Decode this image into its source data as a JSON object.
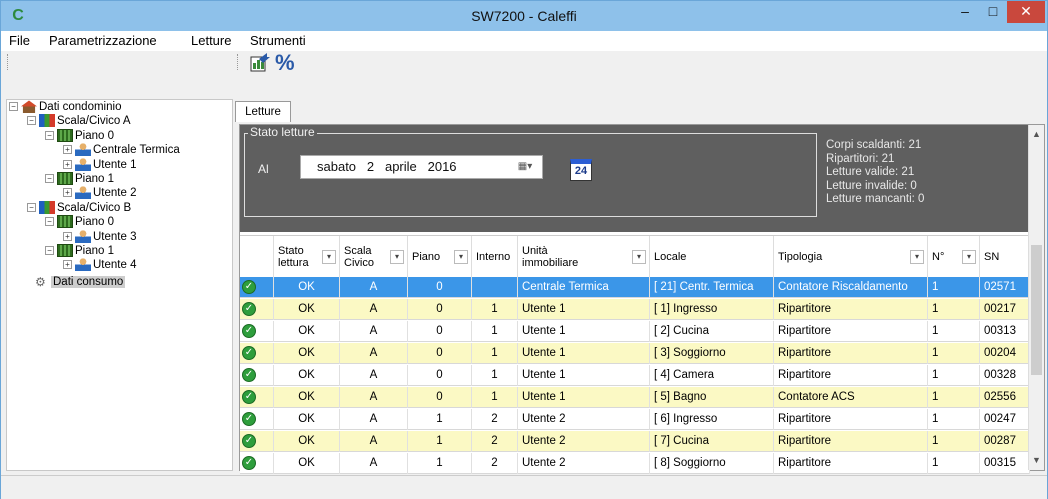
{
  "window": {
    "title": "SW7200 - Caleffi",
    "app_icon": "C",
    "buttons": {
      "minimize": "–",
      "maximize": "□",
      "close": "✕"
    }
  },
  "menu": [
    "File",
    "Parametrizzazione",
    "Letture",
    "Strumenti"
  ],
  "toolbar": {
    "chart_icon": "chart-export-icon",
    "percent": "%"
  },
  "tree": {
    "root": "Dati condominio",
    "scala_a": "Scala/Civico A",
    "piano_a0": "Piano  0",
    "centrale": "Centrale Termica",
    "utente1": "Utente 1",
    "piano_a1": "Piano  1",
    "utente2": "Utente 2",
    "scala_b": "Scala/Civico B",
    "piano_b0": "Piano  0",
    "utente3": "Utente 3",
    "piano_b1": "Piano  1",
    "utente4": "Utente 4",
    "consumo": "Dati consumo"
  },
  "tab": "Letture",
  "stato": {
    "legend": "Stato letture",
    "al": "Al",
    "date_day": "sabato",
    "date_num": "2",
    "date_month": "aprile",
    "date_year": "2016",
    "calendar_num": "24",
    "summary": [
      "Corpi scaldanti: 21",
      "Ripartitori: 21",
      "Letture valide: 21",
      "Letture invalide: 0",
      "Letture mancanti: 0"
    ]
  },
  "columns": {
    "stato": "Stato lettura",
    "scala": "Scala Civico",
    "piano": "Piano",
    "interno": "Interno",
    "unita": "Unità immobiliare",
    "locale": "Locale",
    "tipologia": "Tipologia",
    "numero": "N°",
    "sn": "SN"
  },
  "rows": [
    {
      "stato": "OK",
      "scala": "A",
      "piano": "0",
      "interno": "",
      "unita": "Centrale Termica",
      "locale": "[ 21] Centr. Termica",
      "tipologia": "Contatore Riscaldamento",
      "n": "1",
      "sn": "02571"
    },
    {
      "stato": "OK",
      "scala": "A",
      "piano": "0",
      "interno": "1",
      "unita": "Utente 1",
      "locale": "[  1] Ingresso",
      "tipologia": "Ripartitore",
      "n": "1",
      "sn": "00217"
    },
    {
      "stato": "OK",
      "scala": "A",
      "piano": "0",
      "interno": "1",
      "unita": "Utente 1",
      "locale": "[  2] Cucina",
      "tipologia": "Ripartitore",
      "n": "1",
      "sn": "00313"
    },
    {
      "stato": "OK",
      "scala": "A",
      "piano": "0",
      "interno": "1",
      "unita": "Utente 1",
      "locale": "[  3] Soggiorno",
      "tipologia": "Ripartitore",
      "n": "1",
      "sn": "00204"
    },
    {
      "stato": "OK",
      "scala": "A",
      "piano": "0",
      "interno": "1",
      "unita": "Utente 1",
      "locale": "[  4] Camera",
      "tipologia": "Ripartitore",
      "n": "1",
      "sn": "00328"
    },
    {
      "stato": "OK",
      "scala": "A",
      "piano": "0",
      "interno": "1",
      "unita": "Utente 1",
      "locale": "[  5] Bagno",
      "tipologia": "Contatore ACS",
      "n": "1",
      "sn": "02556"
    },
    {
      "stato": "OK",
      "scala": "A",
      "piano": "1",
      "interno": "2",
      "unita": "Utente 2",
      "locale": "[  6] Ingresso",
      "tipologia": "Ripartitore",
      "n": "1",
      "sn": "00247"
    },
    {
      "stato": "OK",
      "scala": "A",
      "piano": "1",
      "interno": "2",
      "unita": "Utente 2",
      "locale": "[  7] Cucina",
      "tipologia": "Ripartitore",
      "n": "1",
      "sn": "00287"
    },
    {
      "stato": "OK",
      "scala": "A",
      "piano": "1",
      "interno": "2",
      "unita": "Utente 2",
      "locale": "[  8] Soggiorno",
      "tipologia": "Ripartitore",
      "n": "1",
      "sn": "00315"
    }
  ]
}
